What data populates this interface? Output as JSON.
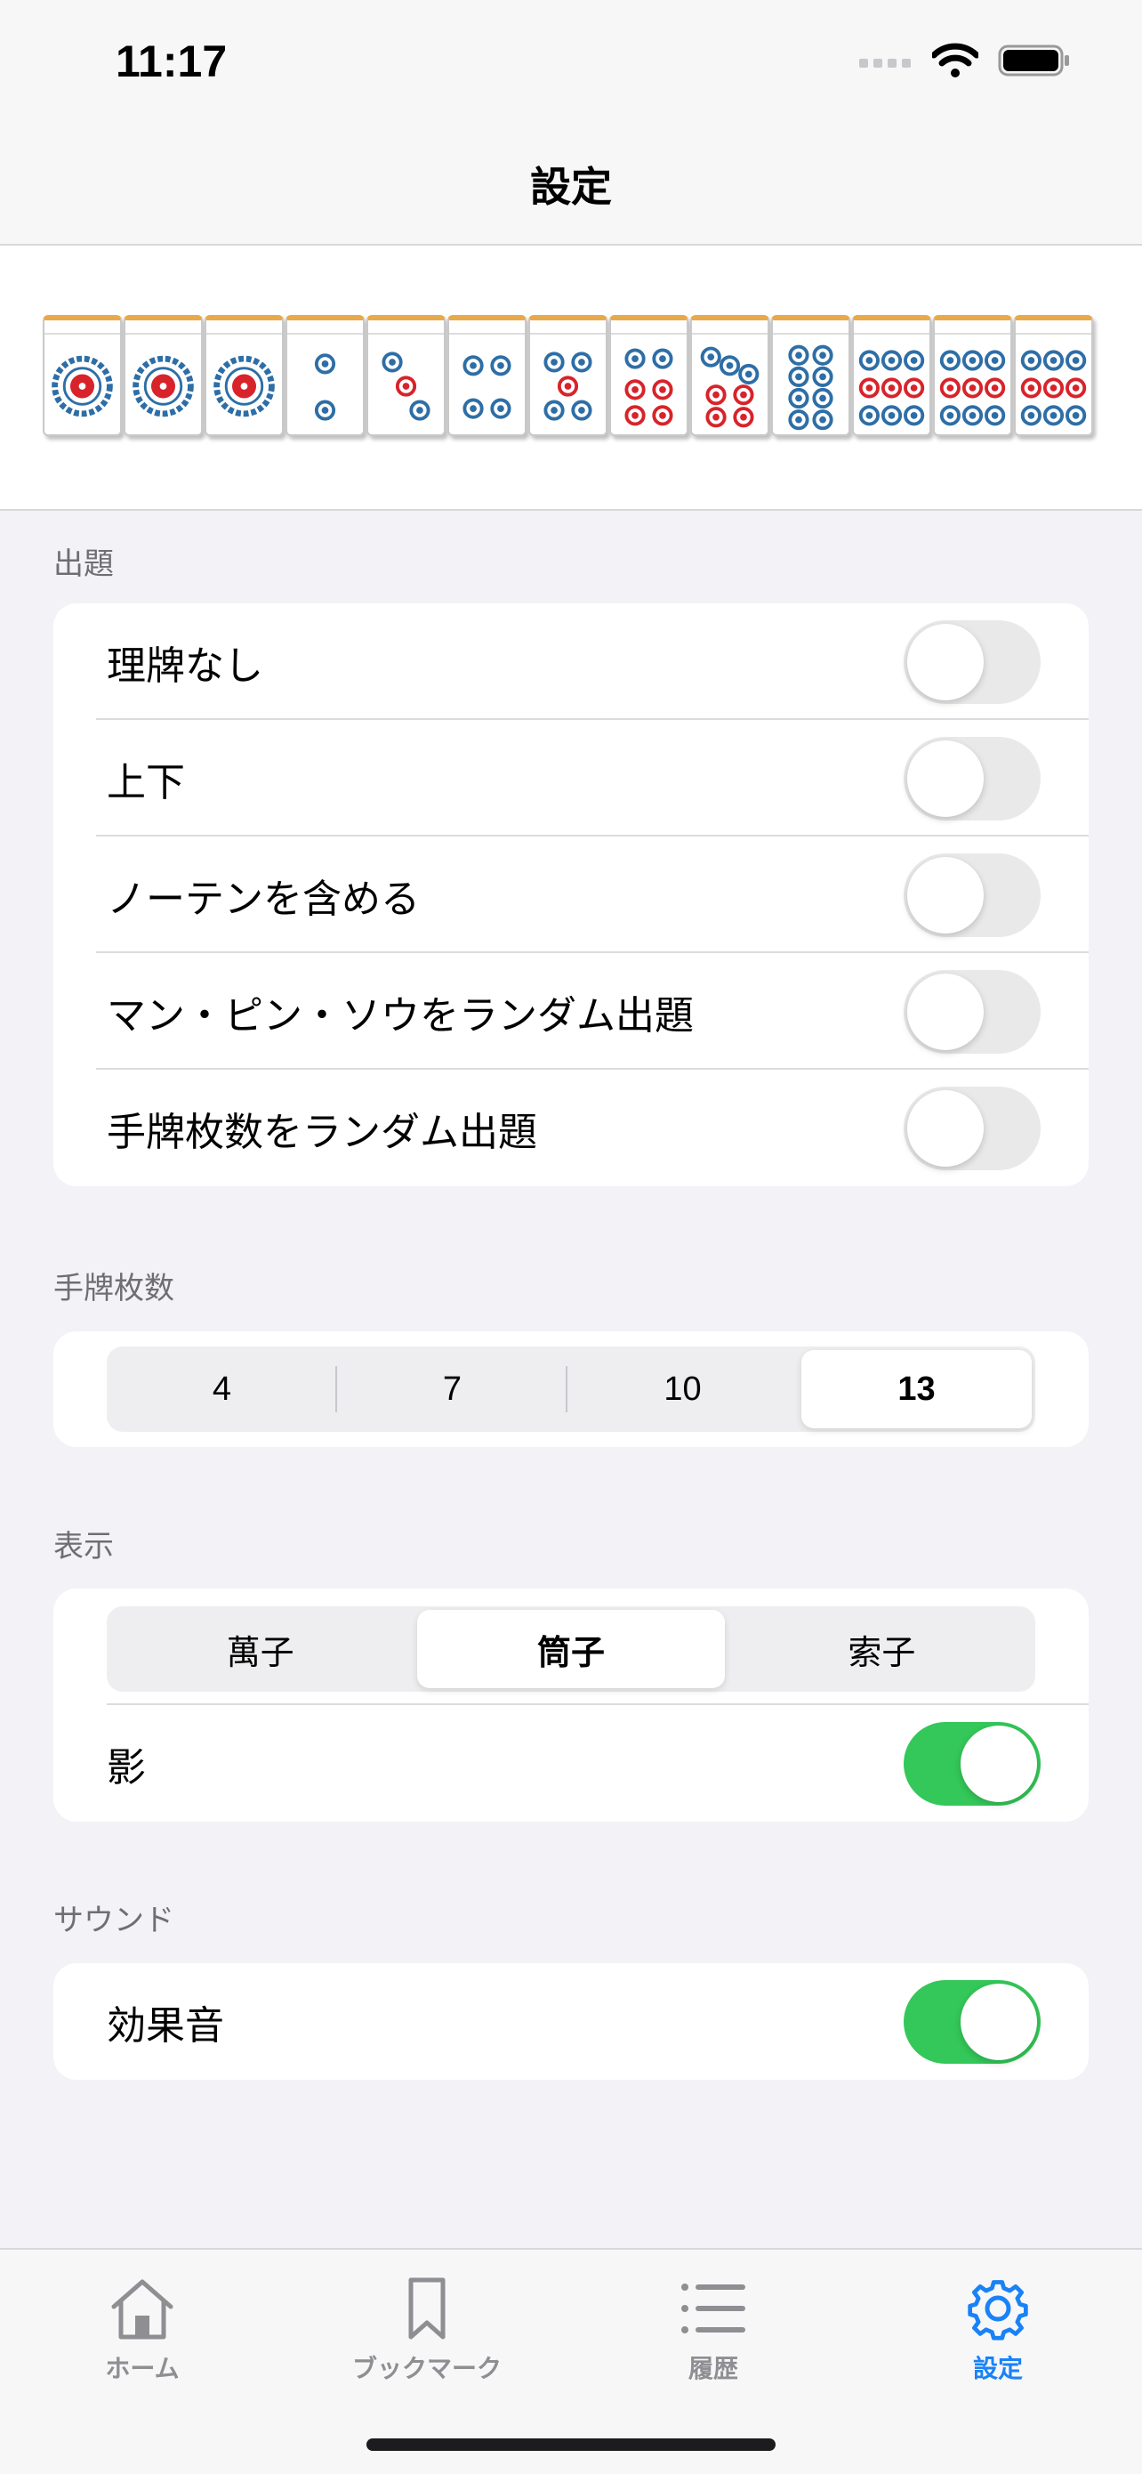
{
  "status": {
    "time": "11:17"
  },
  "nav": {
    "title": "設定"
  },
  "banner": {
    "tiles": [
      "1p",
      "1p",
      "1p",
      "2p",
      "3p",
      "4p",
      "5p",
      "6p",
      "7p",
      "8p",
      "9p",
      "9p",
      "9p"
    ]
  },
  "sections": {
    "question": {
      "header": "出題",
      "rows": [
        {
          "label": "理牌なし",
          "on": false
        },
        {
          "label": "上下",
          "on": false
        },
        {
          "label": "ノーテンを含める",
          "on": false
        },
        {
          "label": "マン・ピン・ソウをランダム出題",
          "on": false
        },
        {
          "label": "手牌枚数をランダム出題",
          "on": false
        }
      ]
    },
    "hand_count": {
      "header": "手牌枚数",
      "options": [
        "4",
        "7",
        "10",
        "13"
      ],
      "selected": "13"
    },
    "display": {
      "header": "表示",
      "options": [
        "萬子",
        "筒子",
        "索子"
      ],
      "selected": "筒子",
      "shadow_label": "影",
      "shadow_on": true
    },
    "sound": {
      "header": "サウンド",
      "effect_label": "効果音",
      "effect_on": true
    }
  },
  "tabs": [
    {
      "label": "ホーム",
      "icon": "house-icon",
      "active": false
    },
    {
      "label": "ブックマーク",
      "icon": "bookmark-icon",
      "active": false
    },
    {
      "label": "履歴",
      "icon": "list-icon",
      "active": false
    },
    {
      "label": "設定",
      "icon": "gear-icon",
      "active": true
    }
  ],
  "colors": {
    "accent": "#1a82f7",
    "toggle_on": "#34c759",
    "pin_blue": "#2e6ea6",
    "pin_red": "#d8232a"
  }
}
